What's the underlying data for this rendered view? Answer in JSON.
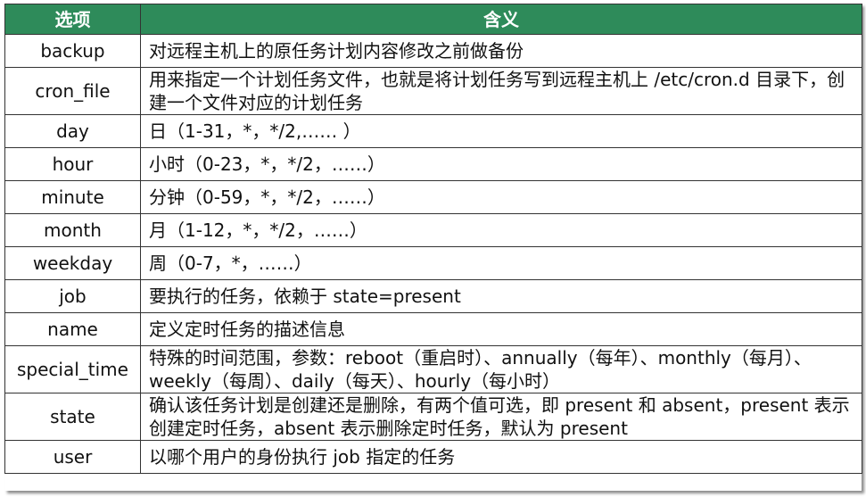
{
  "header": {
    "col_option": "选项",
    "col_meaning": "含义"
  },
  "rows": [
    {
      "option": "backup",
      "meaning": "对远程主机上的原任务计划内容修改之前做备份"
    },
    {
      "option": "cron_file",
      "meaning": "用来指定一个计划任务文件，也就是将计划任务写到远程主机上 /etc/cron.d 目录下，创建一个文件对应的计划任务"
    },
    {
      "option": "day",
      "meaning": "日（1-31，*，*/2,…… ）"
    },
    {
      "option": "hour",
      "meaning": "小时（0-23，*，*/2，……）"
    },
    {
      "option": "minute",
      "meaning": "分钟（0-59，*，*/2，……）"
    },
    {
      "option": "month",
      "meaning": "月（1-12，*，*/2，……）"
    },
    {
      "option": "weekday",
      "meaning": "周（0-7，*，……）"
    },
    {
      "option": "job",
      "meaning": "要执行的任务，依赖于 state=present"
    },
    {
      "option": "name",
      "meaning": "定义定时任务的描述信息"
    },
    {
      "option": "special_time",
      "meaning": "特殊的时间范围，参数：reboot（重启时）、annually（每年）、monthly（每月）、weekly（每周）、daily（每天）、hourly（每小时）"
    },
    {
      "option": "state",
      "meaning": "确认该任务计划是创建还是删除，有两个值可选，即 present 和 absent，present 表示创建定时任务，absent 表示删除定时任务，默认为 present"
    },
    {
      "option": "user",
      "meaning": "以哪个用户的身份执行 job 指定的任务"
    }
  ],
  "colors": {
    "header_bg": "#2e8b5a",
    "header_text": "#ffffff"
  }
}
